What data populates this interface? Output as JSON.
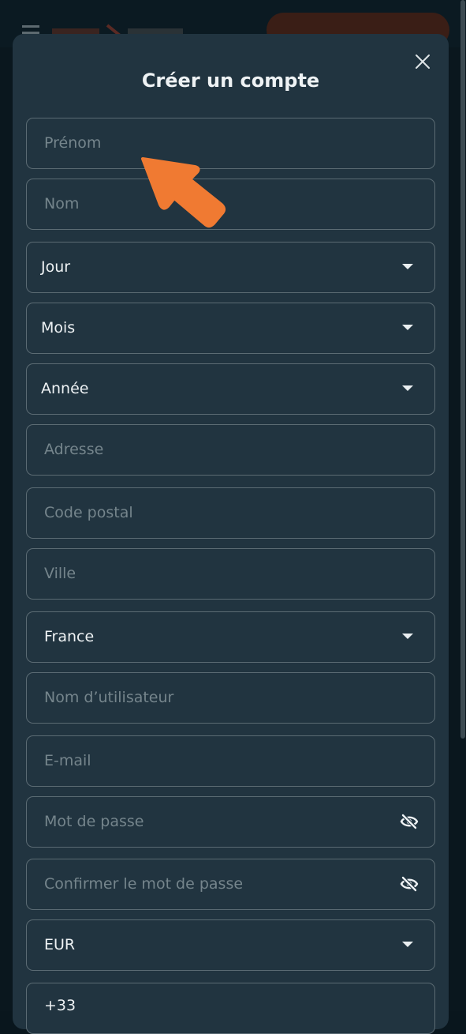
{
  "modal": {
    "title": "Créer un compte"
  },
  "fields": {
    "first_name_placeholder": "Prénom",
    "last_name_placeholder": "Nom",
    "day_value": "Jour",
    "month_value": "Mois",
    "year_value": "Année",
    "address_placeholder": "Adresse",
    "postal_code_placeholder": "Code postal",
    "city_placeholder": "Ville",
    "country_value": "France",
    "username_placeholder": "Nom d’utilisateur",
    "email_placeholder": "E-mail",
    "password_placeholder": "Mot de passe",
    "confirm_password_placeholder": "Confirmer le mot de passe",
    "currency_value": "EUR",
    "phone_prefix": "+33"
  },
  "icons": {
    "close": "close-icon",
    "caret": "caret-down-icon",
    "eye": "eye-off-icon",
    "pointer": "arrow-pointer-icon"
  },
  "colors": {
    "modal_bg": "#213440",
    "field_border": "#5b6b73",
    "accent_pointer": "#f07a32"
  }
}
